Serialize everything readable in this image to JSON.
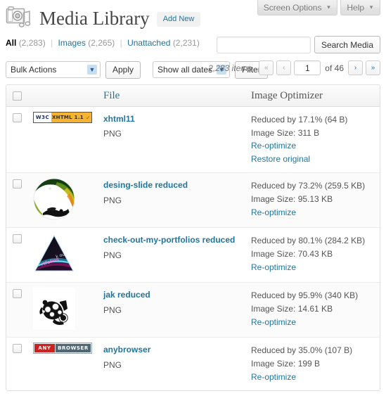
{
  "meta_buttons": [
    {
      "label": "Screen Options",
      "icon": "chevron-down-icon",
      "caret": "▼"
    },
    {
      "label": "Help",
      "icon": "chevron-down-icon",
      "caret": "▼"
    }
  ],
  "header": {
    "icon": "media-library-icon",
    "title": "Media Library",
    "add_new_label": "Add New"
  },
  "subsubsub": [
    {
      "label": "All",
      "count": "(2,283)",
      "current": true
    },
    {
      "label": "Images",
      "count": "(2,265)",
      "current": false
    },
    {
      "label": "Unattached",
      "count": "(2,231)",
      "current": false
    }
  ],
  "separator": "|",
  "search": {
    "value": "",
    "placeholder": "",
    "button_label": "Search Media"
  },
  "tablenav": {
    "bulk_actions": {
      "selected": "Bulk Actions",
      "arrow": "▼"
    },
    "apply_label": "Apply",
    "dates": {
      "selected": "Show all dates",
      "arrow": "▼"
    },
    "filter_label": "Filter"
  },
  "pagination": {
    "items_text": "2,283 items",
    "first_label": "«",
    "prev_label": "‹",
    "current_page": "1",
    "total_text": "of 46",
    "next_label": "›",
    "last_label": "»"
  },
  "table": {
    "columns": {
      "checkbox": "",
      "icon": "",
      "file": "File",
      "optimizer": "Image Optimizer"
    },
    "rows": [
      {
        "thumb": "xhtml11-badge-icon",
        "name": "xhtml11",
        "type": "PNG",
        "reduced": "Reduced by 17.1% (64 B)",
        "size": "Image Size: 311 B",
        "actions": [
          "Re-optimize",
          "Restore original"
        ]
      },
      {
        "thumb": "desing-slide-circle-thumbnail",
        "name": "desing-slide reduced",
        "type": "PNG",
        "reduced": "Reduced by 73.2% (259.5 KB)",
        "size": "Image Size: 95.13 KB",
        "actions": [
          "Re-optimize"
        ]
      },
      {
        "thumb": "portfolios-triangle-thumbnail",
        "name": "check-out-my-portfolios reduced",
        "type": "PNG",
        "reduced": "Reduced by 80.1% (284.2 KB)",
        "size": "Image Size: 70.43 KB",
        "actions": [
          "Re-optimize"
        ]
      },
      {
        "thumb": "jak-graffiti-thumbnail",
        "name": "jak reduced",
        "type": "PNG",
        "reduced": "Reduced by 95.9% (340 KB)",
        "size": "Image Size: 14.61 KB",
        "actions": [
          "Re-optimize"
        ]
      },
      {
        "thumb": "anybrowser-badge-icon",
        "name": "anybrowser",
        "type": "PNG",
        "reduced": "Reduced by 35.0% (107 B)",
        "size": "Image Size: 199 B",
        "actions": [
          "Re-optimize"
        ]
      }
    ]
  },
  "badges": {
    "xhtml": {
      "left": "W3C",
      "right": "XHTML 1.1",
      "tick": "✓"
    },
    "anybrowser": {
      "left": "ANY",
      "right": "BROWSER"
    }
  },
  "colors": {
    "link": "#21759b",
    "badge_orange": "#f6b332",
    "badge_red": "#cc2222",
    "badge_slate": "#4e6876"
  }
}
